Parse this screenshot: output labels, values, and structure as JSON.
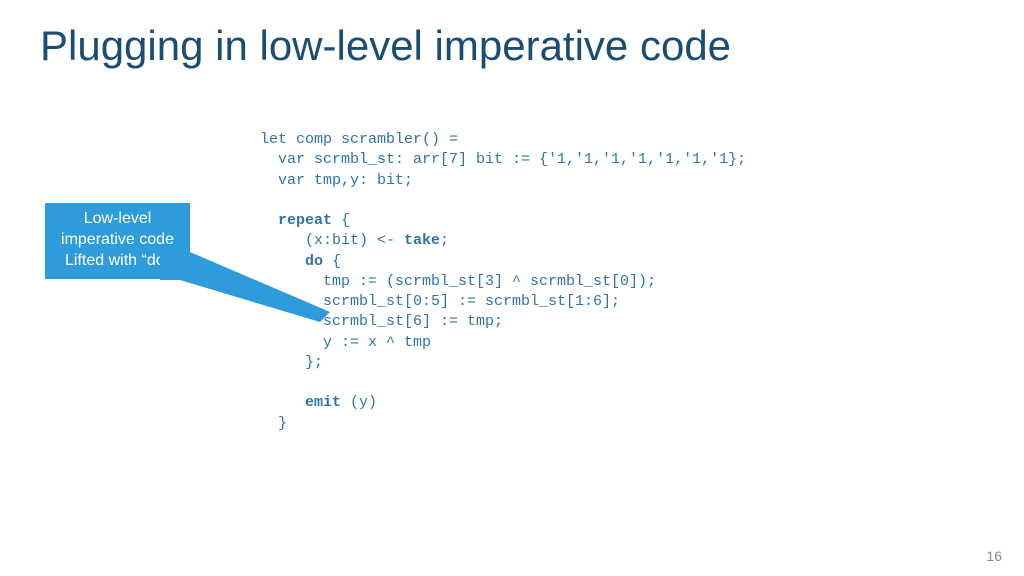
{
  "title": "Plugging in low-level imperative code",
  "callout": {
    "line1": "Low-level",
    "line2": "imperative code",
    "line3": "Lifted with “do”"
  },
  "code": {
    "l1": "let comp scrambler() =",
    "l2": "  var scrmbl_st: arr[7] bit := {'1,'1,'1,'1,'1,'1,'1};",
    "l3": "  var tmp,y: bit;",
    "l4": "",
    "l5a": "  ",
    "l5b": "repeat",
    "l5c": " {",
    "l6a": "     (x:bit) <- ",
    "l6b": "take",
    "l6c": ";",
    "l7a": "     ",
    "l7b": "do",
    "l7c": " {",
    "l8": "       tmp := (scrmbl_st[3] ^ scrmbl_st[0]);",
    "l9": "       scrmbl_st[0:5] := scrmbl_st[1:6];",
    "l10": "       scrmbl_st[6] := tmp;",
    "l11": "       y := x ^ tmp",
    "l12": "     };",
    "l13": "",
    "l14a": "     ",
    "l14b": "emit",
    "l14c": " (y)",
    "l15": "  }"
  },
  "page_number": "16"
}
